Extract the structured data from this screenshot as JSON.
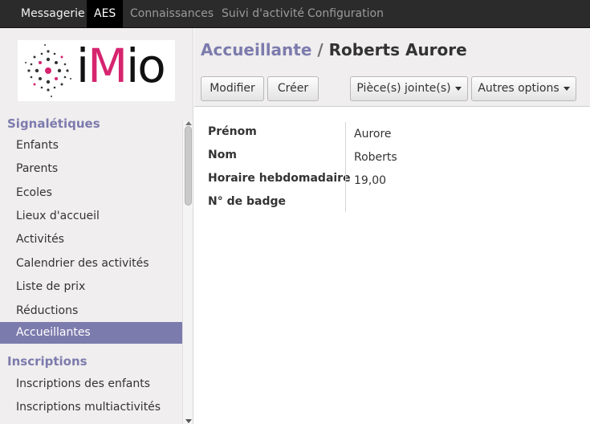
{
  "topbar": {
    "items": [
      "Messagerie",
      "AES",
      "Connaissances",
      "Suivi d'activité",
      "Configuration"
    ]
  },
  "logo": {
    "i": "i",
    "M": "M",
    "io": "io"
  },
  "sidebar": {
    "section_signaletiques": "Signalétiques",
    "signaletiques": [
      "Enfants",
      "Parents",
      "Ecoles",
      "Lieux d'accueil",
      "Activités",
      "Calendrier des activités",
      "Liste de prix",
      "Réductions",
      "Accueillantes"
    ],
    "section_inscriptions": "Inscriptions",
    "inscriptions": [
      "Inscriptions des enfants",
      "Inscriptions multiactivités"
    ]
  },
  "breadcrumb": {
    "parent": "Accueillante",
    "separator": " / ",
    "current": "Roberts Aurore"
  },
  "toolbar": {
    "edit": "Modifier",
    "create": "Créer",
    "attachments": "Pièce(s) jointe(s)",
    "more": "Autres options"
  },
  "form": {
    "fields": [
      {
        "label": "Prénom",
        "value": "Aurore"
      },
      {
        "label": "Nom",
        "value": "Roberts"
      },
      {
        "label": "Horaire hebdomadaire",
        "value": "19,00"
      },
      {
        "label": "N° de badge",
        "value": ""
      }
    ]
  },
  "colors": {
    "accent": "#7c7bad",
    "topbar": "#2b2b2b",
    "logo_pink": "#d6246e"
  }
}
